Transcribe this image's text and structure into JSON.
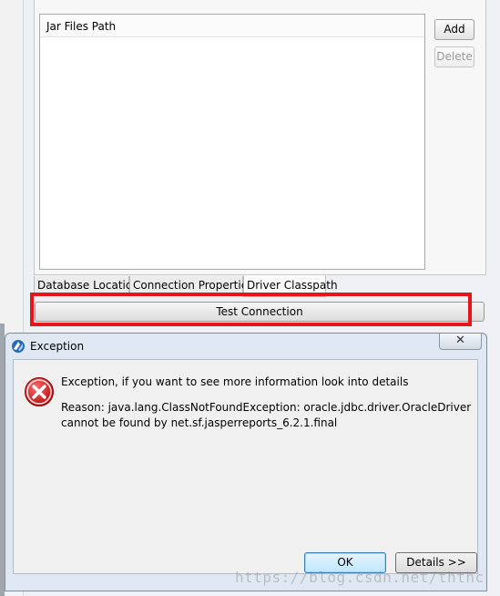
{
  "background_window": {
    "jar_table": {
      "header": "Jar Files Path"
    },
    "buttons": {
      "add": "Add",
      "delete": "Delete"
    },
    "tabs": [
      {
        "label": "Database Location"
      },
      {
        "label": "Connection Properties"
      },
      {
        "label": "Driver Classpath",
        "active": true
      }
    ],
    "test_connection": "Test Connection"
  },
  "dialog": {
    "title": "Exception",
    "close_glyph": "✕",
    "message": "Exception, if you want to see more information look into details",
    "reason": "Reason: java.lang.ClassNotFoundException: oracle.jdbc.driver.OracleDriver cannot be found by net.sf.jasperreports_6.2.1.final",
    "buttons": {
      "ok": "OK",
      "details": "Details >>"
    },
    "icon": "error-icon"
  },
  "annotation": {
    "highlight_color": "#e8141b"
  },
  "watermark": "https://blog.csdn.net/ththc"
}
